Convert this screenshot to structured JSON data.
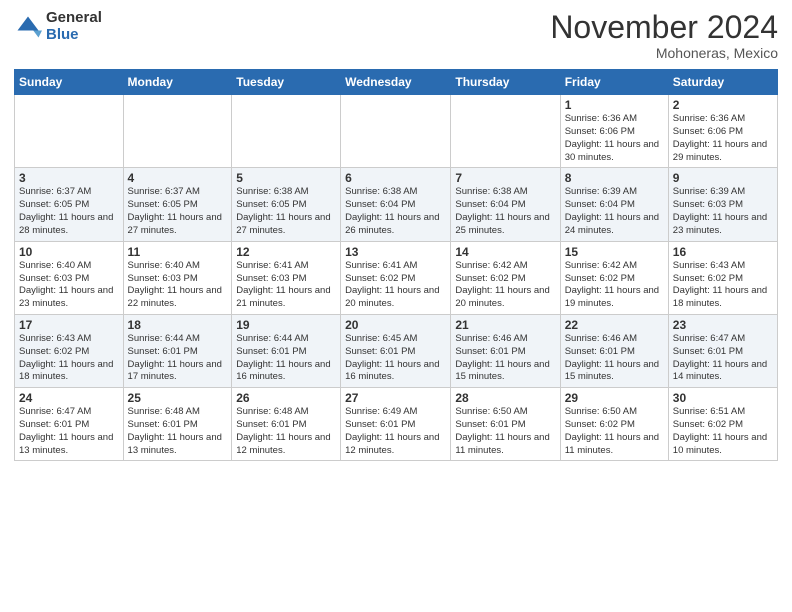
{
  "header": {
    "logo_general": "General",
    "logo_blue": "Blue",
    "month": "November 2024",
    "location": "Mohoneras, Mexico"
  },
  "weekdays": [
    "Sunday",
    "Monday",
    "Tuesday",
    "Wednesday",
    "Thursday",
    "Friday",
    "Saturday"
  ],
  "weeks": [
    [
      {
        "day": "",
        "info": ""
      },
      {
        "day": "",
        "info": ""
      },
      {
        "day": "",
        "info": ""
      },
      {
        "day": "",
        "info": ""
      },
      {
        "day": "",
        "info": ""
      },
      {
        "day": "1",
        "info": "Sunrise: 6:36 AM\nSunset: 6:06 PM\nDaylight: 11 hours and 30 minutes."
      },
      {
        "day": "2",
        "info": "Sunrise: 6:36 AM\nSunset: 6:06 PM\nDaylight: 11 hours and 29 minutes."
      }
    ],
    [
      {
        "day": "3",
        "info": "Sunrise: 6:37 AM\nSunset: 6:05 PM\nDaylight: 11 hours and 28 minutes."
      },
      {
        "day": "4",
        "info": "Sunrise: 6:37 AM\nSunset: 6:05 PM\nDaylight: 11 hours and 27 minutes."
      },
      {
        "day": "5",
        "info": "Sunrise: 6:38 AM\nSunset: 6:05 PM\nDaylight: 11 hours and 27 minutes."
      },
      {
        "day": "6",
        "info": "Sunrise: 6:38 AM\nSunset: 6:04 PM\nDaylight: 11 hours and 26 minutes."
      },
      {
        "day": "7",
        "info": "Sunrise: 6:38 AM\nSunset: 6:04 PM\nDaylight: 11 hours and 25 minutes."
      },
      {
        "day": "8",
        "info": "Sunrise: 6:39 AM\nSunset: 6:04 PM\nDaylight: 11 hours and 24 minutes."
      },
      {
        "day": "9",
        "info": "Sunrise: 6:39 AM\nSunset: 6:03 PM\nDaylight: 11 hours and 23 minutes."
      }
    ],
    [
      {
        "day": "10",
        "info": "Sunrise: 6:40 AM\nSunset: 6:03 PM\nDaylight: 11 hours and 23 minutes."
      },
      {
        "day": "11",
        "info": "Sunrise: 6:40 AM\nSunset: 6:03 PM\nDaylight: 11 hours and 22 minutes."
      },
      {
        "day": "12",
        "info": "Sunrise: 6:41 AM\nSunset: 6:03 PM\nDaylight: 11 hours and 21 minutes."
      },
      {
        "day": "13",
        "info": "Sunrise: 6:41 AM\nSunset: 6:02 PM\nDaylight: 11 hours and 20 minutes."
      },
      {
        "day": "14",
        "info": "Sunrise: 6:42 AM\nSunset: 6:02 PM\nDaylight: 11 hours and 20 minutes."
      },
      {
        "day": "15",
        "info": "Sunrise: 6:42 AM\nSunset: 6:02 PM\nDaylight: 11 hours and 19 minutes."
      },
      {
        "day": "16",
        "info": "Sunrise: 6:43 AM\nSunset: 6:02 PM\nDaylight: 11 hours and 18 minutes."
      }
    ],
    [
      {
        "day": "17",
        "info": "Sunrise: 6:43 AM\nSunset: 6:02 PM\nDaylight: 11 hours and 18 minutes."
      },
      {
        "day": "18",
        "info": "Sunrise: 6:44 AM\nSunset: 6:01 PM\nDaylight: 11 hours and 17 minutes."
      },
      {
        "day": "19",
        "info": "Sunrise: 6:44 AM\nSunset: 6:01 PM\nDaylight: 11 hours and 16 minutes."
      },
      {
        "day": "20",
        "info": "Sunrise: 6:45 AM\nSunset: 6:01 PM\nDaylight: 11 hours and 16 minutes."
      },
      {
        "day": "21",
        "info": "Sunrise: 6:46 AM\nSunset: 6:01 PM\nDaylight: 11 hours and 15 minutes."
      },
      {
        "day": "22",
        "info": "Sunrise: 6:46 AM\nSunset: 6:01 PM\nDaylight: 11 hours and 15 minutes."
      },
      {
        "day": "23",
        "info": "Sunrise: 6:47 AM\nSunset: 6:01 PM\nDaylight: 11 hours and 14 minutes."
      }
    ],
    [
      {
        "day": "24",
        "info": "Sunrise: 6:47 AM\nSunset: 6:01 PM\nDaylight: 11 hours and 13 minutes."
      },
      {
        "day": "25",
        "info": "Sunrise: 6:48 AM\nSunset: 6:01 PM\nDaylight: 11 hours and 13 minutes."
      },
      {
        "day": "26",
        "info": "Sunrise: 6:48 AM\nSunset: 6:01 PM\nDaylight: 11 hours and 12 minutes."
      },
      {
        "day": "27",
        "info": "Sunrise: 6:49 AM\nSunset: 6:01 PM\nDaylight: 11 hours and 12 minutes."
      },
      {
        "day": "28",
        "info": "Sunrise: 6:50 AM\nSunset: 6:01 PM\nDaylight: 11 hours and 11 minutes."
      },
      {
        "day": "29",
        "info": "Sunrise: 6:50 AM\nSunset: 6:02 PM\nDaylight: 11 hours and 11 minutes."
      },
      {
        "day": "30",
        "info": "Sunrise: 6:51 AM\nSunset: 6:02 PM\nDaylight: 11 hours and 10 minutes."
      }
    ]
  ]
}
